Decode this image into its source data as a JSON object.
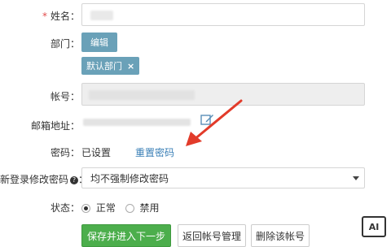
{
  "form": {
    "name": {
      "required_mark": "*",
      "label": "姓名："
    },
    "department": {
      "label": "部门：",
      "edit_label": "编辑",
      "tag_label": "默认部门",
      "tag_remove": "×"
    },
    "account": {
      "label": "帐号："
    },
    "email": {
      "label": "邮箱地址："
    },
    "password": {
      "label": "密码：",
      "status": "已设置",
      "reset_link": "重置密码"
    },
    "force_change": {
      "label": "新登录修改密码",
      "help": "?",
      "selected_option": "均不强制修改密码"
    },
    "status": {
      "label": "状态：",
      "options": [
        {
          "label": "正常",
          "selected": true
        },
        {
          "label": "禁用",
          "selected": false
        }
      ]
    }
  },
  "actions": {
    "save_next": "保存并进入下一步",
    "back": "返回帐号管理",
    "delete": "删除该帐号"
  },
  "annotation": {
    "arrow_color": "#e23b2a"
  },
  "watermark": {
    "text": "AI"
  },
  "colors": {
    "accent_teal": "#6aa1b8",
    "primary_green": "#4cae4c",
    "link_blue": "#3a7fb6",
    "required_red": "#e24b4b"
  }
}
